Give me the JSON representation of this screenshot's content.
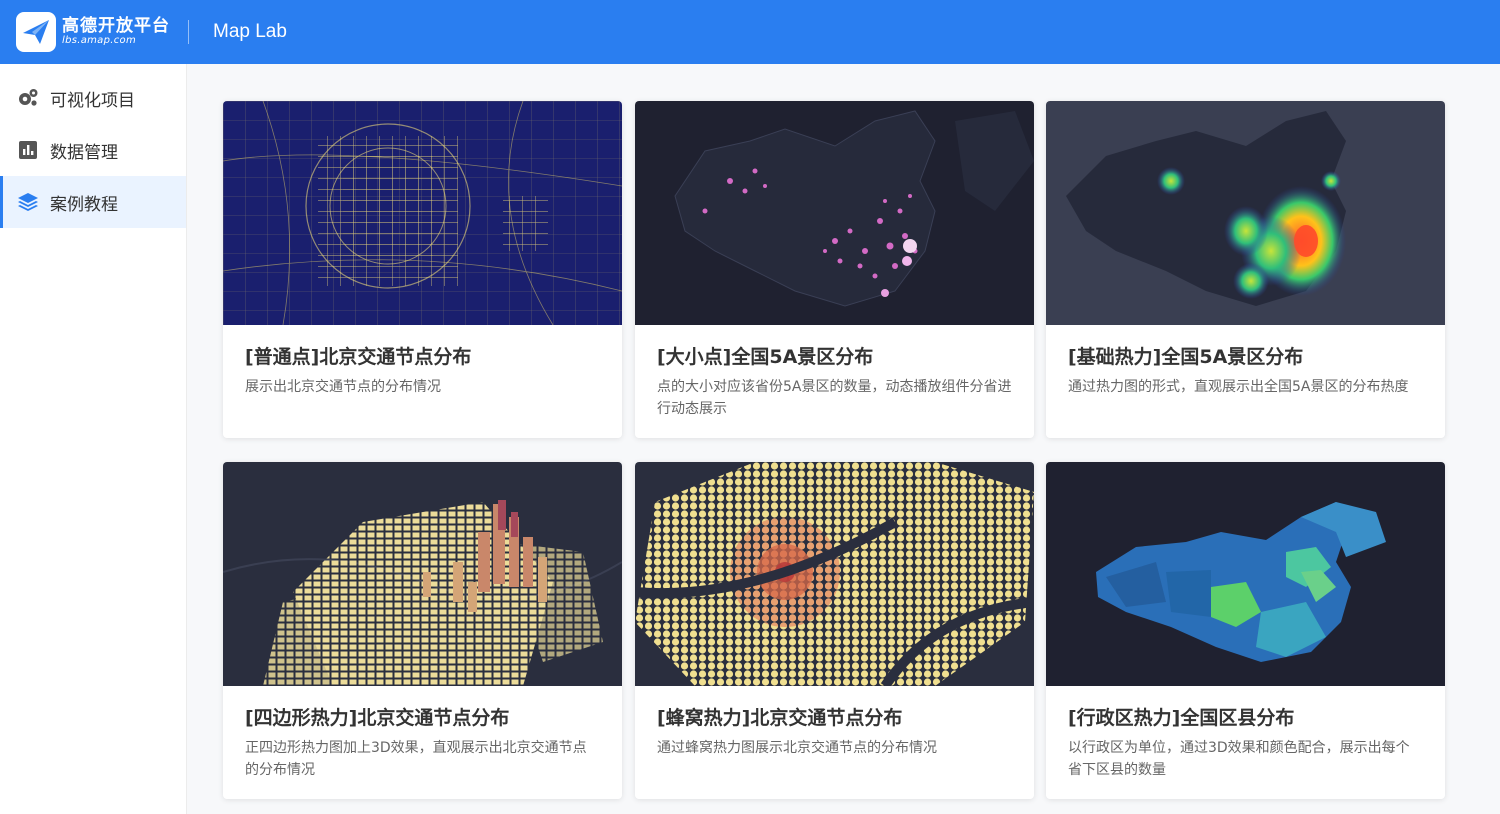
{
  "header": {
    "logo_name": "高德开放平台",
    "logo_url": "lbs.amap.com",
    "app_title": "Map Lab",
    "accent": "#2a7ef0"
  },
  "sidebar": {
    "items": [
      {
        "label": "可视化项目",
        "icon": "gear-cluster-icon",
        "active": false
      },
      {
        "label": "数据管理",
        "icon": "bar-chart-icon",
        "active": false
      },
      {
        "label": "案例教程",
        "icon": "layers-icon",
        "active": true
      }
    ]
  },
  "cards": [
    {
      "title": "[普通点]北京交通节点分布",
      "desc": "展示出北京交通节点的分布情况",
      "thumb": "beijing-traffic-points-map"
    },
    {
      "title": "[大小点]全国5A景区分布",
      "desc": "点的大小对应该省份5A景区的数量，动态播放组件分省进行动态展示",
      "thumb": "china-5a-size-points-map"
    },
    {
      "title": "[基础热力]全国5A景区分布",
      "desc": "通过热力图的形式，直观展示出全国5A景区的分布热度",
      "thumb": "china-5a-heatmap"
    },
    {
      "title": "[四边形热力]北京交通节点分布",
      "desc": "正四边形热力图加上3D效果，直观展示出北京交通节点的分布情况",
      "thumb": "beijing-3d-square-heatmap"
    },
    {
      "title": "[蜂窝热力]北京交通节点分布",
      "desc": "通过蜂窝热力图展示北京交通节点的分布情况",
      "thumb": "beijing-hexbin-heatmap"
    },
    {
      "title": "[行政区热力]全国区县分布",
      "desc": "以行政区为单位，通过3D效果和颜色配合，展示出每个省下区县的数量",
      "thumb": "china-district-choropleth"
    }
  ]
}
